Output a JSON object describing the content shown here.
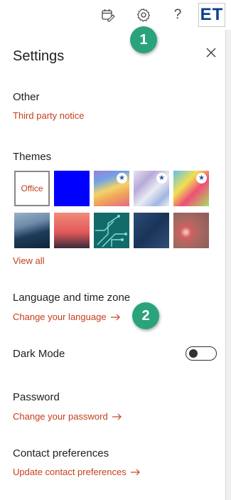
{
  "topbar": {
    "calendar_icon": "calendar-edit-icon",
    "gear_icon": "gear-icon",
    "help_glyph": "?",
    "avatar_initials": "ET"
  },
  "settings": {
    "title": "Settings",
    "close_icon": "close-icon"
  },
  "other": {
    "heading": "Other",
    "link": "Third party notice"
  },
  "themes": {
    "heading": "Themes",
    "office_tile_label": "Office",
    "view_all": "View all"
  },
  "language": {
    "heading": "Language and time zone",
    "link": "Change your language"
  },
  "dark_mode": {
    "label": "Dark Mode",
    "enabled": false
  },
  "password": {
    "heading": "Password",
    "link": "Change your password"
  },
  "contact": {
    "heading": "Contact preferences",
    "link": "Update contact preferences"
  },
  "callouts": [
    "1",
    "2"
  ],
  "colors": {
    "accent_link": "#c43e1c",
    "callout_green": "#2aa37c"
  }
}
